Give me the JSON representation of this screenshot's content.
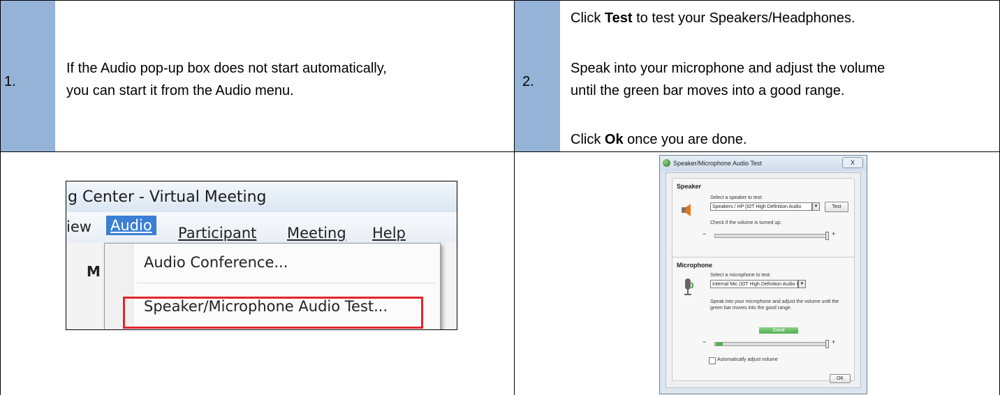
{
  "steps": [
    {
      "number": "1.",
      "line1": "If the Audio pop-up box does not start automatically,",
      "line2": "you can start it from the Audio menu."
    },
    {
      "number": "2.",
      "p1_before": "Click ",
      "p1_bold": "Test",
      "p1_after": " to test your Speakers/Headphones.",
      "p2_line1": "Speak into your microphone and adjust the volume",
      "p2_line2": "until the green bar moves into a good range.",
      "p3_before": "Click ",
      "p3_bold": "Ok",
      "p3_after": " once you are done."
    }
  ],
  "menu_screenshot": {
    "window_title": "g Center - Virtual Meeting",
    "menus": {
      "view_partial": "iew",
      "audio": "Audio",
      "participant": "Participant",
      "meeting": "Meeting",
      "help": "Help"
    },
    "dropdown": {
      "item1": "Audio Conference...",
      "item2": "Speaker/Microphone Audio Test..."
    },
    "partial_toolbar_text": "M"
  },
  "dialog_screenshot": {
    "title": "Speaker/Microphone Audio Test",
    "close_symbol": "X",
    "speaker": {
      "heading": "Speaker",
      "select_label": "Select a speaker to test:",
      "selected": "Speakers / HP (IDT High Definition Audio",
      "test_button": "Test",
      "volume_label": "Check if the volume is turned up:"
    },
    "microphone": {
      "heading": "Microphone",
      "select_label": "Select a microphone to test:",
      "selected": "Internal Mic (IDT High Definition Audio CC",
      "instruction_line1": "Speak into your microphone and adjust the volume until the",
      "instruction_line2": "green bar moves into the good range.",
      "level_label": "Good",
      "auto_adjust_label": "Automatically adjust volume"
    },
    "minus": "−",
    "plus": "+",
    "ok_button": "OK",
    "colors": {
      "good_bar": "#4caf50",
      "highlight": "#e0252b",
      "step_cell": "#95b3d7"
    }
  }
}
